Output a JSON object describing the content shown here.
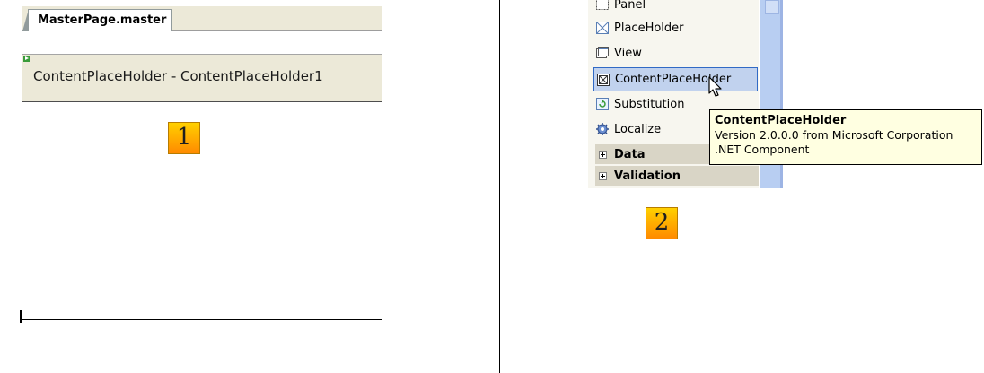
{
  "designer": {
    "tab_label": "MasterPage.master",
    "placeholder_label": "ContentPlaceHolder - ContentPlaceHolder1",
    "callout_number": "1"
  },
  "toolbox": {
    "items": [
      {
        "label": "Panel",
        "icon": "panel-icon"
      },
      {
        "label": "PlaceHolder",
        "icon": "placeholder-icon"
      },
      {
        "label": "View",
        "icon": "view-icon"
      },
      {
        "label": "ContentPlaceHolder",
        "icon": "contentplaceholder-icon",
        "selected": true
      },
      {
        "label": "Substitution",
        "icon": "substitution-icon"
      },
      {
        "label": "Localize",
        "icon": "localize-gear-icon"
      }
    ],
    "categories": [
      {
        "label": "Data"
      },
      {
        "label": "Validation"
      }
    ],
    "tooltip": {
      "title": "ContentPlaceHolder",
      "version": "Version 2.0.0.0 from Microsoft Corporation",
      "component": ".NET Component"
    },
    "callout_number": "2"
  },
  "colors": {
    "toolbox_selection": "#c1d2ee",
    "selection_border": "#316ac5",
    "tooltip_bg": "#ffffe1",
    "callout": "#ff9a00"
  }
}
